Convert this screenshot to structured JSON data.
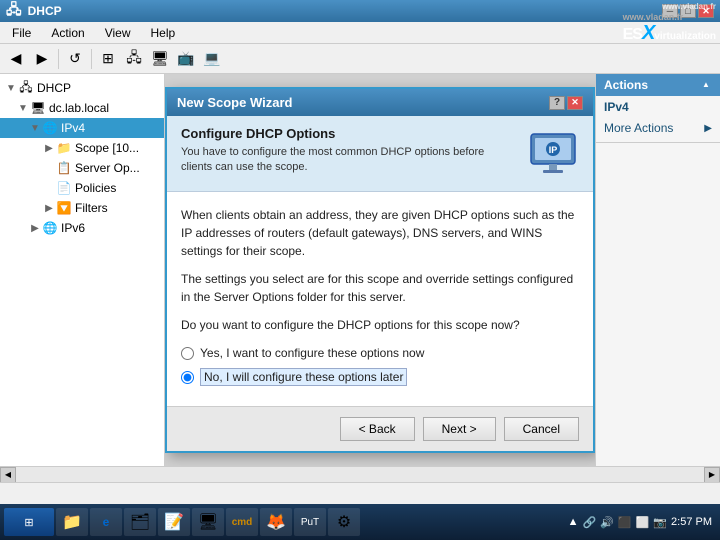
{
  "window": {
    "title": "DHCP",
    "esx_url": "www.vladan.fr",
    "esx_brand": "ESXvirtualization"
  },
  "menu": {
    "items": [
      "File",
      "Action",
      "View",
      "Help"
    ]
  },
  "tree": {
    "root": "DHCP",
    "nodes": [
      {
        "label": "dc.lab.local",
        "level": 1,
        "expanded": true
      },
      {
        "label": "IPv4",
        "level": 2,
        "expanded": true
      },
      {
        "label": "Scope [10...",
        "level": 3,
        "expanded": false
      },
      {
        "label": "Server Op...",
        "level": 3,
        "expanded": false
      },
      {
        "label": "Policies",
        "level": 3,
        "expanded": false
      },
      {
        "label": "Filters",
        "level": 3,
        "expanded": false
      },
      {
        "label": "IPv6",
        "level": 2,
        "expanded": false
      }
    ]
  },
  "right_panel": {
    "title": "Actions",
    "section": "IPv4",
    "more_actions": "More Actions"
  },
  "dialog": {
    "title": "New Scope Wizard",
    "header_title": "Configure DHCP Options",
    "header_desc": "You have to configure the most common DHCP options before clients can use the scope.",
    "body_para1": "When clients obtain an address, they are given DHCP options such as the IP addresses of routers (default gateways), DNS servers, and WINS settings for their scope.",
    "body_para2": "The settings you select are for this scope and override settings configured in the Server Options folder for this server.",
    "question": "Do you want to configure the DHCP options for this scope now?",
    "radio_yes": "Yes, I want to configure these options now",
    "radio_no": "No, I will configure these options later",
    "selected_radio": "no",
    "btn_back": "< Back",
    "btn_next": "Next >",
    "btn_cancel": "Cancel"
  },
  "status_bar": {
    "text": ""
  },
  "taskbar": {
    "time": "2:57 PM",
    "apps": [
      "⊞",
      "📁",
      "🌐",
      "📄",
      "🖥",
      "📋",
      "►",
      "▶",
      "⚙",
      "🔒"
    ]
  }
}
